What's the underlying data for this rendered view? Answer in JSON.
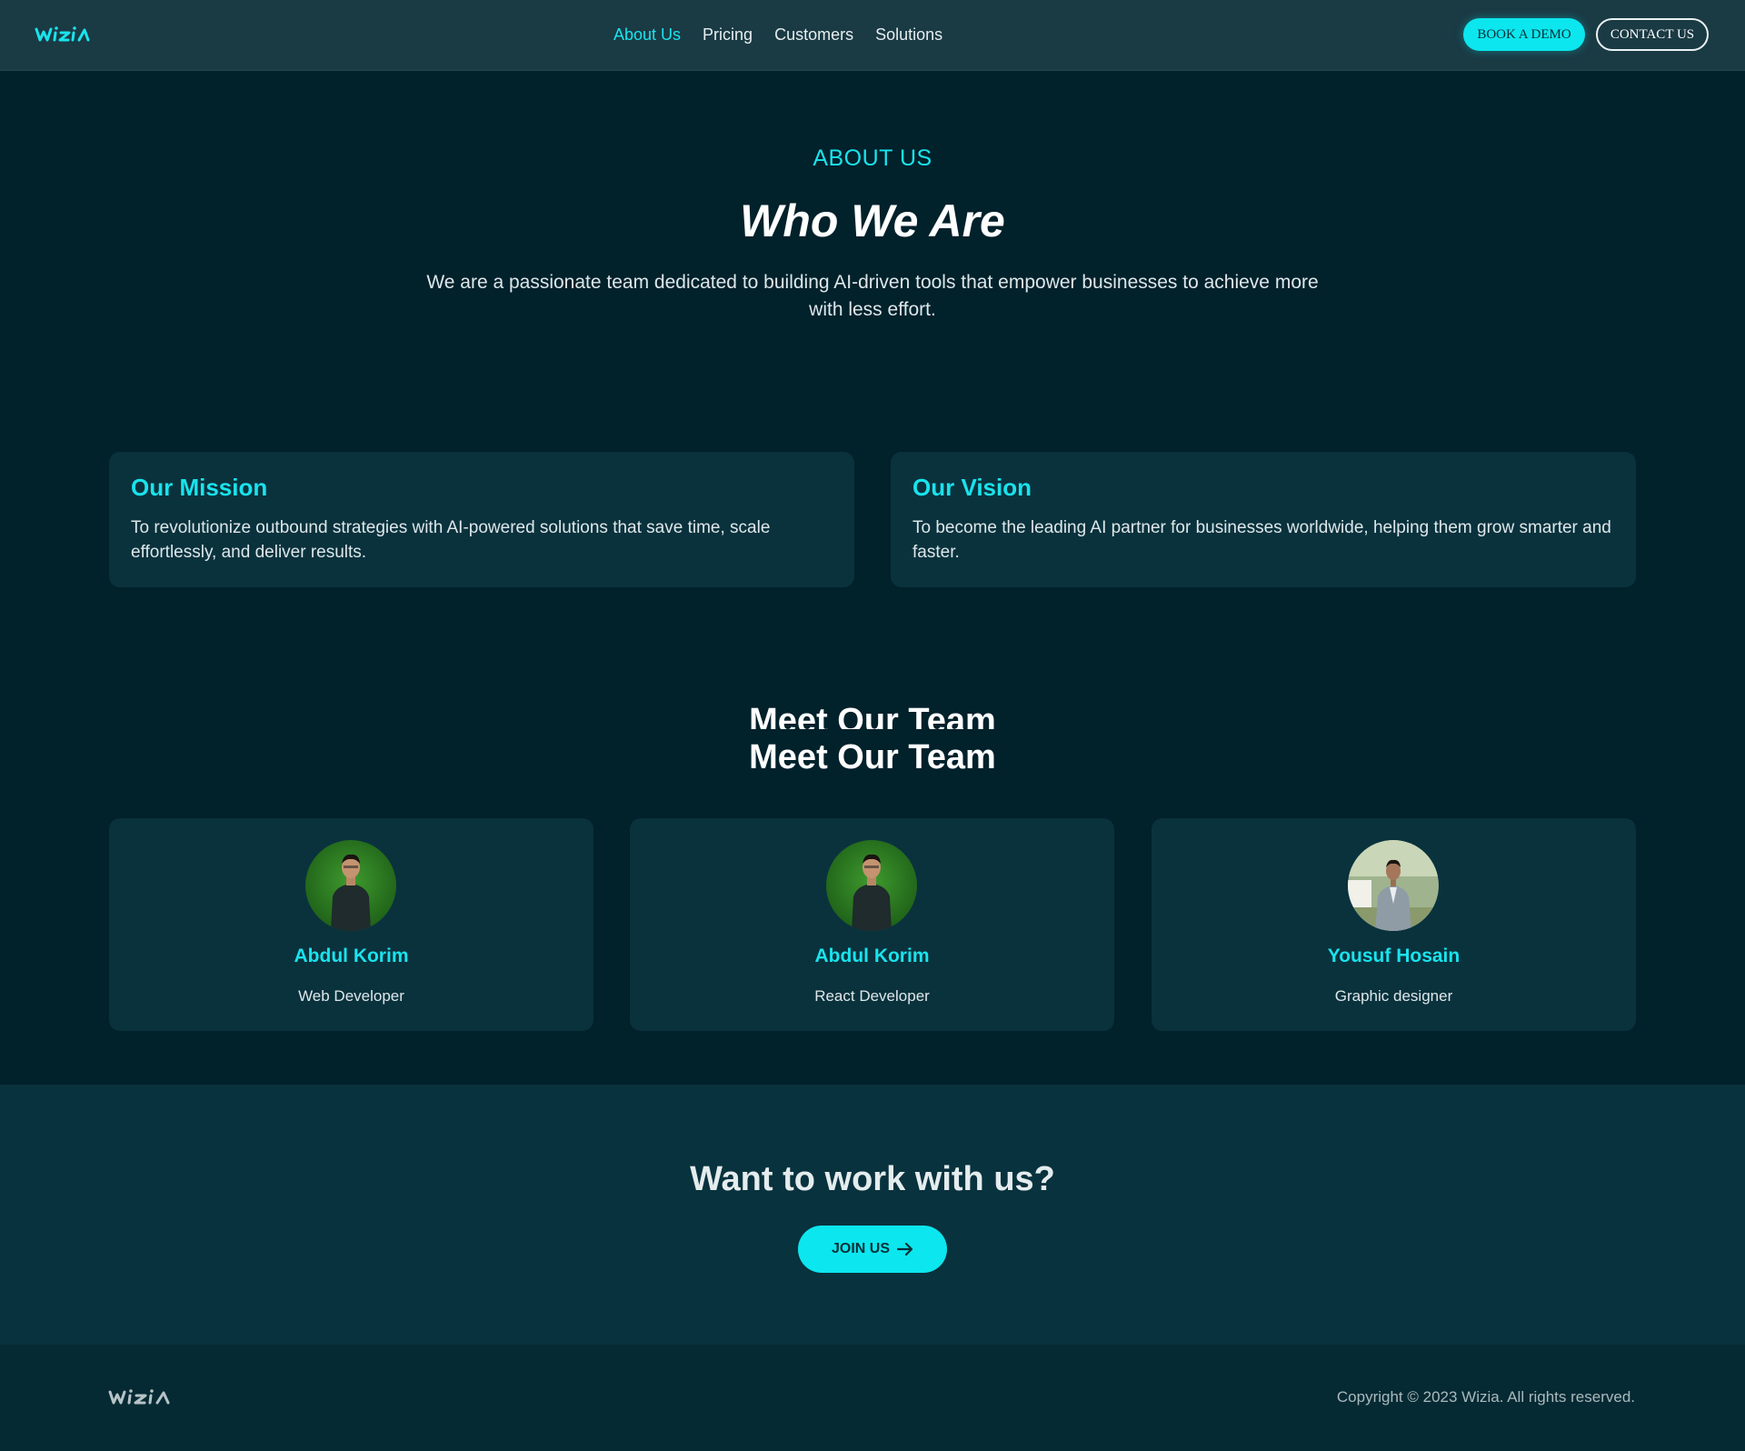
{
  "brand": {
    "logo_text": "wizia"
  },
  "nav": {
    "items": [
      {
        "label": "About Us",
        "active": true
      },
      {
        "label": "Pricing",
        "active": false
      },
      {
        "label": "Customers",
        "active": false
      },
      {
        "label": "Solutions",
        "active": false
      }
    ],
    "book_demo_label": "BOOK A DEMO",
    "contact_label": "CONTACT US"
  },
  "hero": {
    "eyebrow": "ABOUT US",
    "title": "Who We Are",
    "text": "We are a passionate team dedicated to building AI-driven tools that empower businesses to achieve more with less effort."
  },
  "mission": {
    "title": "Our Mission",
    "text": "To revolutionize outbound strategies with AI-powered solutions that save time, scale effortlessly, and deliver results."
  },
  "vision": {
    "title": "Our Vision",
    "text": "To become the leading AI partner for businesses worldwide, helping them grow smarter and faster."
  },
  "team": {
    "title": "Meet Our Team",
    "members": [
      {
        "name": "Abdul Korim",
        "role": "Web Developer"
      },
      {
        "name": "Abdul Korim",
        "role": "React Developer"
      },
      {
        "name": "Yousuf Hosain",
        "role": "Graphic designer"
      }
    ]
  },
  "cta": {
    "title": "Want to work with us?",
    "button_label": "JOIN US"
  },
  "footer": {
    "copyright": "Copyright © 2023 Wizia. All rights reserved."
  },
  "colors": {
    "accent": "#19e3ec",
    "background": "#01212b",
    "card": "#0a323d",
    "header": "#1a3a44"
  }
}
